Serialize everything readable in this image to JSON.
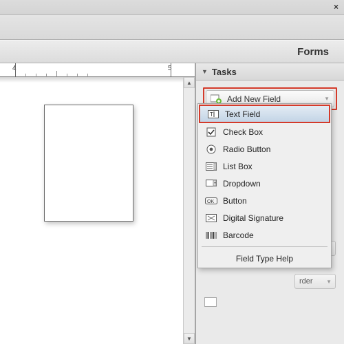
{
  "header": {
    "title": "Forms"
  },
  "sidebar": {
    "tasks_label": "Tasks",
    "add_new_field": "Add New Field"
  },
  "ruler": {
    "marks": [
      "4",
      "5"
    ]
  },
  "dropdown": {
    "items": [
      {
        "label": "Text Field",
        "icon": "text-field-icon",
        "highlight": true
      },
      {
        "label": "Check Box",
        "icon": "checkbox-icon"
      },
      {
        "label": "Radio Button",
        "icon": "radio-icon"
      },
      {
        "label": "List Box",
        "icon": "listbox-icon"
      },
      {
        "label": "Dropdown",
        "icon": "dropdown-icon"
      },
      {
        "label": "Button",
        "icon": "button-icon"
      },
      {
        "label": "Digital Signature",
        "icon": "signature-icon"
      },
      {
        "label": "Barcode",
        "icon": "barcode-icon"
      }
    ],
    "help": "Field Type Help"
  },
  "ghost": {
    "order_fragment": "rder"
  }
}
